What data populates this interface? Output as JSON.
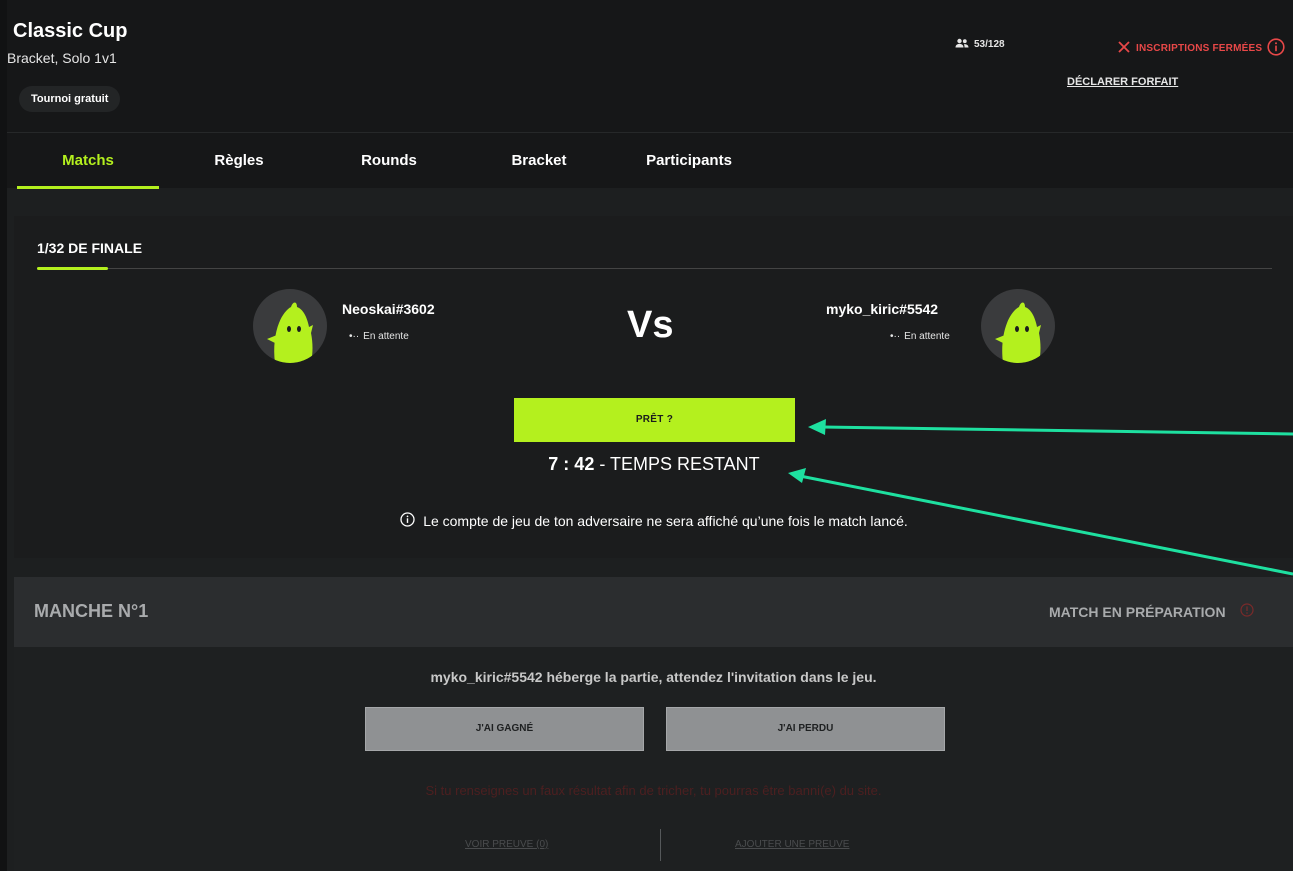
{
  "tournament": {
    "title": "Classic Cup",
    "subtitle": "Bracket, Solo 1v1",
    "badge": "Tournoi gratuit",
    "players_count": "53/128",
    "registration_status": "INSCRIPTIONS FERMÉES",
    "forfeit_label": "DÉCLARER FORFAIT"
  },
  "tabs": [
    {
      "label": "Matchs",
      "active": true
    },
    {
      "label": "Règles"
    },
    {
      "label": "Rounds"
    },
    {
      "label": "Bracket"
    },
    {
      "label": "Participants"
    }
  ],
  "match": {
    "round_title": "1/32 DE FINALE",
    "player1": {
      "name": "Neoskai#3602",
      "status": "En attente"
    },
    "player2": {
      "name": "myko_kiric#5542",
      "status": "En attente"
    },
    "vs_label": "Vs",
    "ready_label": "PRÊT ?",
    "timer_value": "7 : 42",
    "timer_suffix": " - TEMPS RESTANT",
    "info_note": "Le compte de jeu de ton adversaire ne sera affiché qu’une fois le match lancé."
  },
  "round": {
    "title": "MANCHE N°1",
    "status": "MATCH EN PRÉPARATION",
    "host_note": "myko_kiric#5542 héberge la partie, attendez l'invitation dans le jeu.",
    "won_label": "J'AI GAGNÉ",
    "lost_label": "J'AI PERDU",
    "warning": "Si tu renseignes un faux résultat afin de tricher, tu pourras être banni(e) du site.",
    "view_proof": "VOIR PREUVE (0)",
    "add_proof": "AJOUTER UNE PREUVE"
  },
  "colors": {
    "accent": "#b4f01e",
    "danger": "#e84848",
    "annotation": "#1ee0a0"
  },
  "icons": [
    "users-icon",
    "close-icon",
    "info-icon",
    "avatar-monster-icon",
    "alert-icon"
  ]
}
